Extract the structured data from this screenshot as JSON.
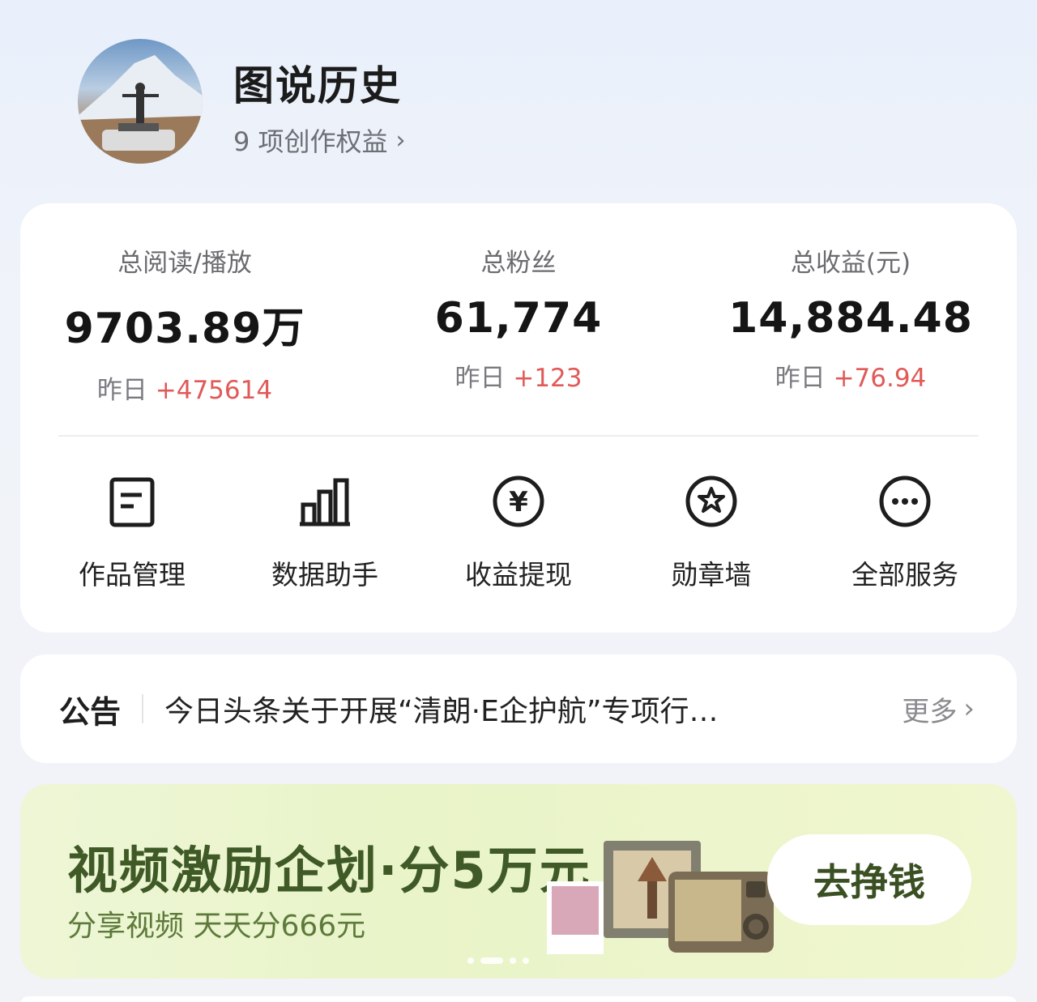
{
  "profile": {
    "name": "图说历史",
    "benefits": "9 项创作权益"
  },
  "stats": [
    {
      "label": "总阅读/播放",
      "value": "9703.89万",
      "delta_prefix": "昨日",
      "delta": "+475614"
    },
    {
      "label": "总粉丝",
      "value": "61,774",
      "delta_prefix": "昨日",
      "delta": "+123"
    },
    {
      "label": "总收益(元)",
      "value": "14,884.48",
      "delta_prefix": "昨日",
      "delta": "+76.94"
    }
  ],
  "tools": [
    {
      "label": "作品管理",
      "icon": "document-icon"
    },
    {
      "label": "数据助手",
      "icon": "bar-chart-icon"
    },
    {
      "label": "收益提现",
      "icon": "yuan-icon"
    },
    {
      "label": "勋章墙",
      "icon": "medal-icon"
    },
    {
      "label": "全部服务",
      "icon": "more-icon"
    }
  ],
  "notice": {
    "tag": "公告",
    "text": "今日头条关于开展“清朗·E企护航”专项行…",
    "more": "更多"
  },
  "banner": {
    "title": "视频激励企划·分5万元",
    "subtitle": "分享视频 天天分666元",
    "button": "去挣钱"
  },
  "colors": {
    "increase": "#e05a58",
    "banner_text": "#3f5a26"
  }
}
